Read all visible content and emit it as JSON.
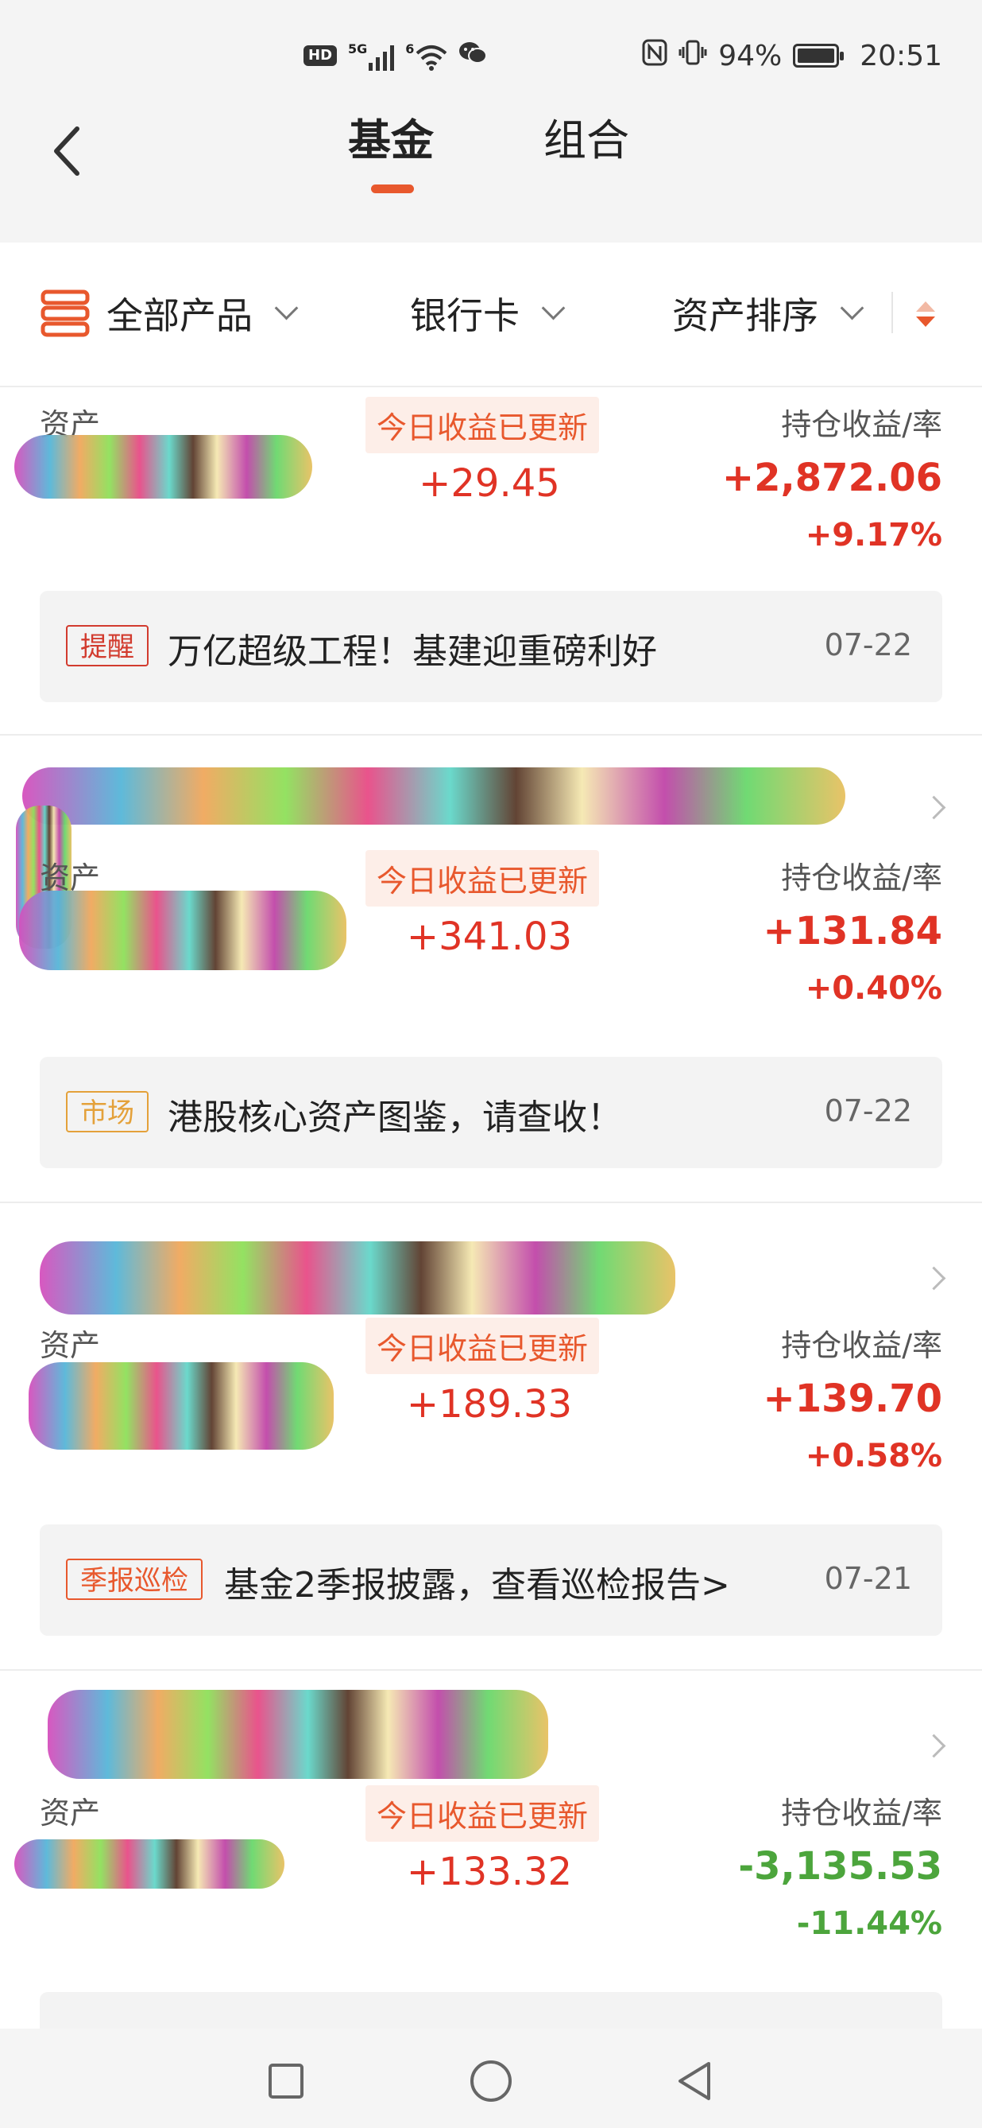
{
  "status_bar": {
    "hd": "HD",
    "net1": "5G",
    "net2": "6",
    "battery_pct": "94%",
    "time": "20:51"
  },
  "header": {
    "tabs": [
      {
        "label": "基金",
        "active": true
      },
      {
        "label": "组合",
        "active": false
      }
    ],
    "accent_color": "#e8582d"
  },
  "filters": {
    "products": "全部产品",
    "bank_card": "银行卡",
    "sort": "资产排序"
  },
  "cards": [
    {
      "asset_label": "资产",
      "today_badge": "今日收益已更新",
      "today_value": "+29.45",
      "holding_label": "持仓收益/率",
      "holding_value": "+2,872.06",
      "holding_rate": "+9.17%",
      "notice": {
        "tag": "提醒",
        "text": "万亿超级工程！基建迎重磅利好",
        "date": "07-22"
      }
    },
    {
      "asset_label": "资产",
      "today_badge": "今日收益已更新",
      "today_value": "+341.03",
      "holding_label": "持仓收益/率",
      "holding_value": "+131.84",
      "holding_rate": "+0.40%",
      "notice": {
        "tag": "市场",
        "text": "港股核心资产图鉴，请查收！",
        "date": "07-22"
      }
    },
    {
      "asset_label": "资产",
      "today_badge": "今日收益已更新",
      "today_value": "+189.33",
      "holding_label": "持仓收益/率",
      "holding_value": "+139.70",
      "holding_rate": "+0.58%",
      "notice": {
        "tag": "季报巡检",
        "text": "基金2季报披露，查看巡检报告>",
        "date": "07-21"
      }
    },
    {
      "asset_label": "资产",
      "today_badge": "今日收益已更新",
      "today_value": "+133.32",
      "holding_label": "持仓收益/率",
      "holding_value": "-3,135.53",
      "holding_rate": "-11.44%"
    }
  ],
  "colors": {
    "gain": "#e03325",
    "loss": "#4ca53c"
  }
}
